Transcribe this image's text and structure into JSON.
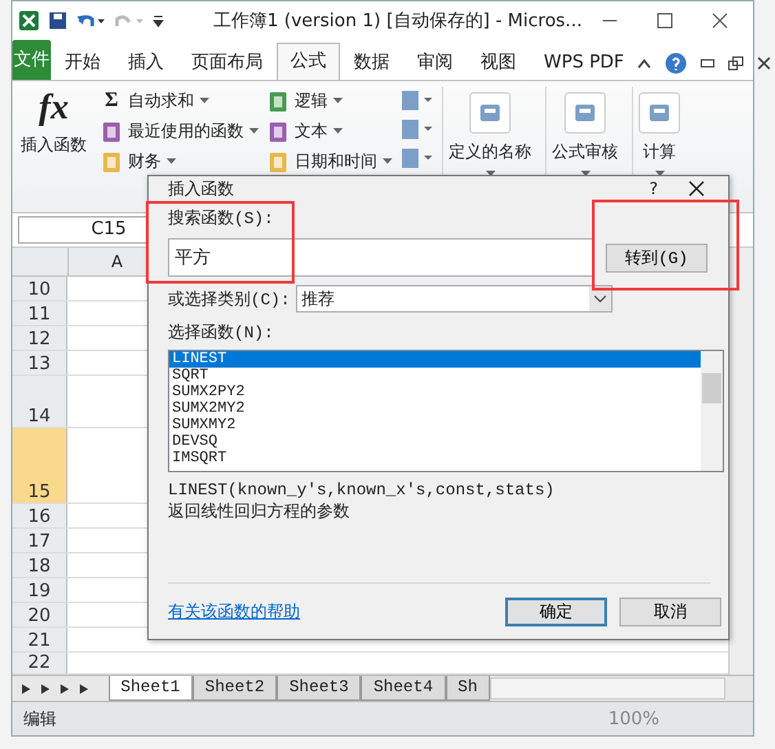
{
  "title_bar": {
    "title": "工作簿1 (version 1) [自动保存的]  -  Micros..."
  },
  "ribbon_tabs": [
    {
      "label": "文件",
      "kind": "file",
      "selected": false
    },
    {
      "label": "开始",
      "kind": "tab",
      "selected": false
    },
    {
      "label": "插入",
      "kind": "tab",
      "selected": false
    },
    {
      "label": "页面布局",
      "kind": "tab",
      "selected": false
    },
    {
      "label": "公式",
      "kind": "tab",
      "selected": true
    },
    {
      "label": "数据",
      "kind": "tab",
      "selected": false
    },
    {
      "label": "审阅",
      "kind": "tab",
      "selected": false
    },
    {
      "label": "视图",
      "kind": "tab",
      "selected": false
    },
    {
      "label": "WPS PDF",
      "kind": "tab",
      "selected": false
    }
  ],
  "ribbon": {
    "fx_label": "fx",
    "insert_function": "插入函数",
    "sum_glyph": "Σ",
    "library_columns": [
      [
        "自动求和",
        "最近使用的函数",
        "财务"
      ],
      [
        "逻辑",
        "文本",
        "日期和时间"
      ]
    ],
    "groups": [
      "定义的名称",
      "公式审核",
      "计算"
    ]
  },
  "name_box": "C15",
  "columns": [
    "A"
  ],
  "rows": [
    {
      "label": "10",
      "selected": false
    },
    {
      "label": "11",
      "selected": false
    },
    {
      "label": "12",
      "selected": false
    },
    {
      "label": "13",
      "selected": false
    },
    {
      "label": "14",
      "selected": false
    },
    {
      "label": "15",
      "selected": true
    },
    {
      "label": "16",
      "selected": false
    },
    {
      "label": "17",
      "selected": false
    },
    {
      "label": "18",
      "selected": false
    },
    {
      "label": "19",
      "selected": false
    },
    {
      "label": "20",
      "selected": false
    },
    {
      "label": "21",
      "selected": false
    },
    {
      "label": "22",
      "selected": false
    }
  ],
  "sheet_tabs": [
    {
      "label": "Sheet1",
      "selected": true
    },
    {
      "label": "Sheet2",
      "selected": false
    },
    {
      "label": "Sheet3",
      "selected": false
    },
    {
      "label": "Sheet4",
      "selected": false
    },
    {
      "label": "Sh",
      "selected": false
    }
  ],
  "status_bar": {
    "mode": "编辑",
    "zoom": "100%"
  },
  "dialog": {
    "title": "插入函数",
    "help": "?",
    "search_label": "搜索函数(S):",
    "search_value": "平方",
    "go_button": "转到(G)",
    "category_label": "或选择类别(C):",
    "category_value": "推荐",
    "list_label": "选择函数(N):",
    "functions": [
      {
        "name": "LINEST",
        "selected": true
      },
      {
        "name": "SQRT",
        "selected": false
      },
      {
        "name": "SUMX2PY2",
        "selected": false
      },
      {
        "name": "SUMX2MY2",
        "selected": false
      },
      {
        "name": "SUMXMY2",
        "selected": false
      },
      {
        "name": "DEVSQ",
        "selected": false
      },
      {
        "name": "IMSQRT",
        "selected": false
      }
    ],
    "signature": "LINEST(known_y's,known_x's,const,stats)",
    "description": "返回线性回归方程的参数",
    "help_link": "有关该函数的帮助",
    "ok": "确定",
    "cancel": "取消"
  }
}
